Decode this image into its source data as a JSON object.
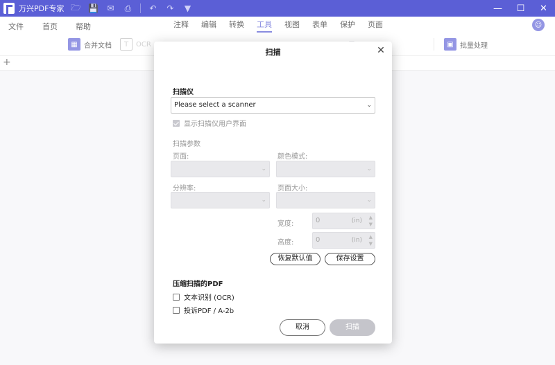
{
  "app": {
    "title": "万兴PDF专家"
  },
  "titlebar_icons": [
    "folder-icon",
    "save-icon",
    "mail-icon",
    "print-icon",
    "undo-icon",
    "redo-icon",
    "dropdown-icon"
  ],
  "window_controls": {
    "minimize": "—",
    "maximize": "☐",
    "close": "✕"
  },
  "menu": {
    "left": [
      "文件",
      "首页",
      "帮助"
    ],
    "center": [
      "注释",
      "编辑",
      "转换",
      "工具",
      "视图",
      "表单",
      "保护",
      "页面"
    ],
    "active": "工具"
  },
  "toolbar": {
    "merge": "合并文档",
    "ocr": "OCR",
    "more": "更多",
    "batch": "批量处理"
  },
  "tabstrip": {
    "new_tab": "+"
  },
  "dialog": {
    "title": "扫描",
    "scanner_section": "扫描仪",
    "scanner_select": "Please select a scanner",
    "show_ui_label": "显示扫描仪用户界面",
    "params_section": "扫描参数",
    "page_label": "页面:",
    "color_mode_label": "颜色模式:",
    "resolution_label": "分辨率:",
    "page_size_label": "页面大小:",
    "width_label": "宽度:",
    "height_label": "高度:",
    "width_value": "0",
    "height_value": "0",
    "unit": "(in)",
    "restore_default": "恢复默认值",
    "save_settings": "保存设置",
    "compress_section": "压缩扫描的PDF",
    "ocr_option": "文本识别 (OCR)",
    "pdfa_option": "投诉PDF / A-2b",
    "cancel": "取消",
    "scan": "扫描"
  },
  "colors": {
    "titlebar": "#5b5fd6",
    "accent": "#4a4fd0",
    "disabled_field": "#e9e9ec"
  }
}
